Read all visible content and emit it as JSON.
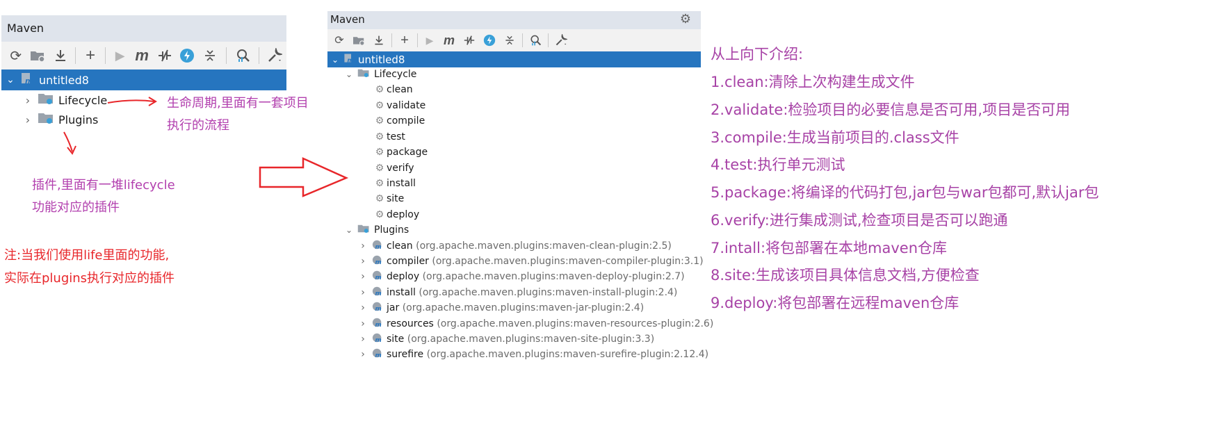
{
  "left_panel": {
    "title": "Maven",
    "root": "untitled8",
    "children": [
      "Lifecycle",
      "Plugins"
    ]
  },
  "right_panel": {
    "title": "Maven",
    "root": "untitled8",
    "lifecycle_label": "Lifecycle",
    "phases": [
      "clean",
      "validate",
      "compile",
      "test",
      "package",
      "verify",
      "install",
      "site",
      "deploy"
    ],
    "plugins_label": "Plugins",
    "plugins": [
      {
        "name": "clean",
        "coord": "(org.apache.maven.plugins:maven-clean-plugin:2.5)"
      },
      {
        "name": "compiler",
        "coord": "(org.apache.maven.plugins:maven-compiler-plugin:3.1)"
      },
      {
        "name": "deploy",
        "coord": "(org.apache.maven.plugins:maven-deploy-plugin:2.7)"
      },
      {
        "name": "install",
        "coord": "(org.apache.maven.plugins:maven-install-plugin:2.4)"
      },
      {
        "name": "jar",
        "coord": "(org.apache.maven.plugins:maven-jar-plugin:2.4)"
      },
      {
        "name": "resources",
        "coord": "(org.apache.maven.plugins:maven-resources-plugin:2.6)"
      },
      {
        "name": "site",
        "coord": "(org.apache.maven.plugins:maven-site-plugin:3.3)"
      },
      {
        "name": "surefire",
        "coord": "(org.apache.maven.plugins:maven-surefire-plugin:2.12.4)"
      }
    ]
  },
  "annotations": {
    "lifecycle_note": [
      "生命周期,里面有一套项目",
      "执行的流程"
    ],
    "plugins_note": [
      "插件,里面有一堆lifecycle",
      "功能对应的插件"
    ],
    "warning_note": [
      "注:当我们使用life里面的功能,",
      "实际在plugins执行对应的插件"
    ]
  },
  "intro": {
    "heading": "从上向下介绍:",
    "items": [
      "1.clean:清除上次构建生成文件",
      "2.validate:检验项目的必要信息是否可用,项目是否可用",
      "3.compile:生成当前项目的.class文件",
      "4.test:执行单元测试",
      "5.package:将编译的代码打包,jar包与war包都可,默认jar包",
      "6.verify:进行集成测试,检查项目是否可以跑通",
      "7.intall:将包部署在本地maven仓库",
      "8.site:生成该项目具体信息文档,方便检查",
      "9.deploy:将包部署在远程maven仓库"
    ]
  },
  "colors": {
    "selection": "#2675bf",
    "annotation_purple": "#b23fae",
    "annotation_red": "#e8262a",
    "arrow_red": "#e8262a"
  }
}
